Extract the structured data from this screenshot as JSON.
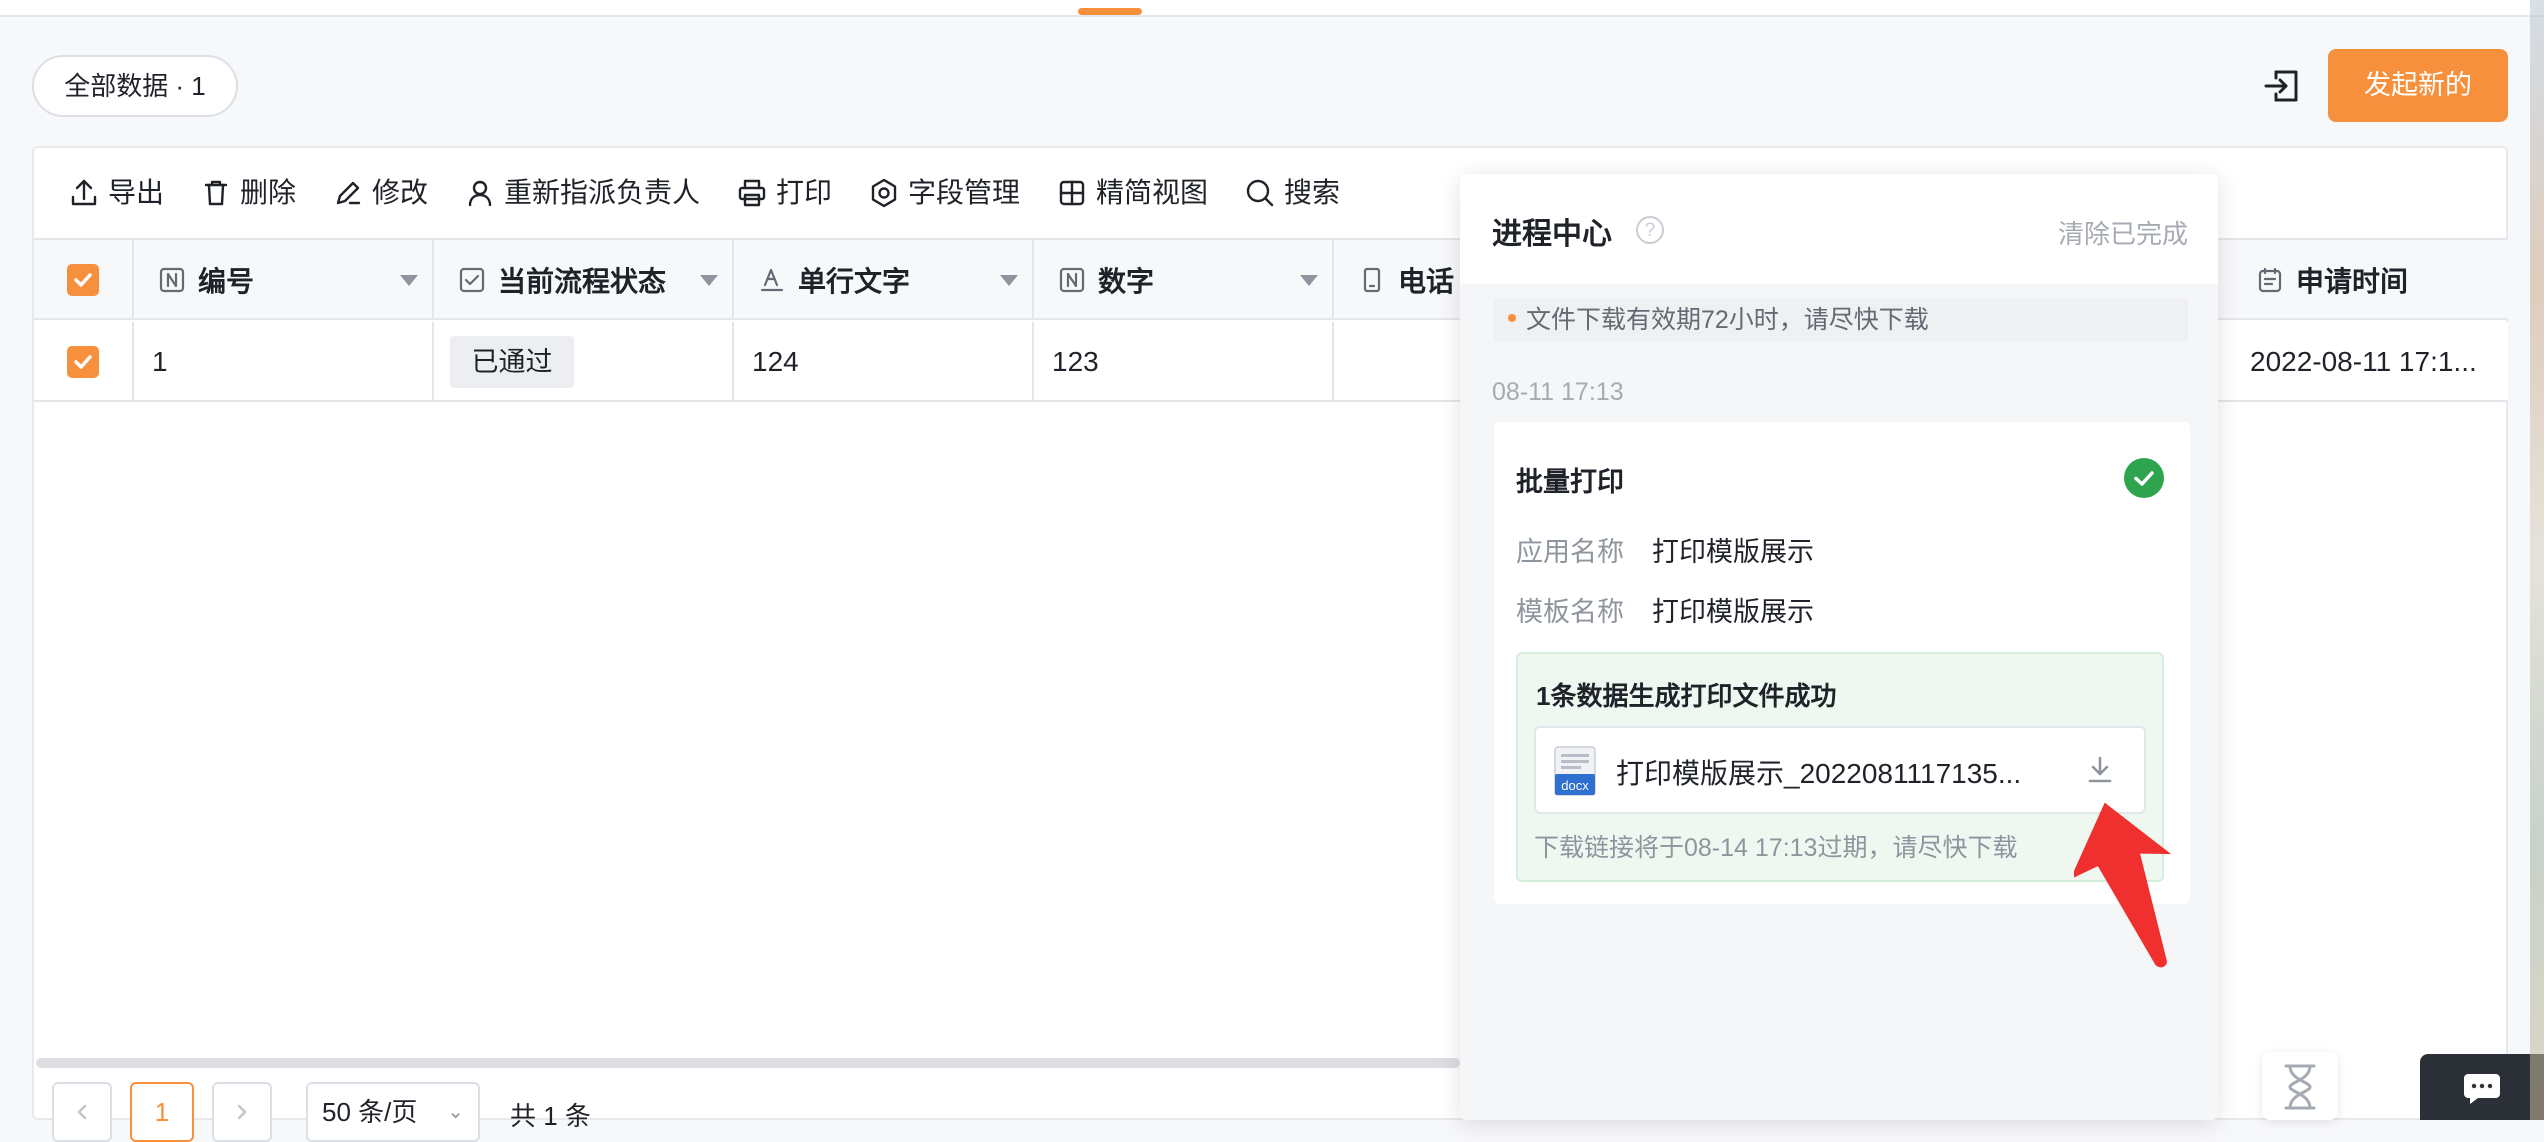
{
  "toolbar_top": {
    "filter_label": "全部数据 · 1",
    "new_button": "发起新的"
  },
  "actions": {
    "export": "导出",
    "delete": "删除",
    "edit": "修改",
    "reassign": "重新指派负责人",
    "print": "打印",
    "fields": "字段管理",
    "compact_view": "精简视图",
    "search": "搜索"
  },
  "columns": {
    "number": "编号",
    "status": "当前流程状态",
    "text": "单行文字",
    "digit": "数字",
    "phone": "电话",
    "apply_time": "申请时间"
  },
  "row": {
    "number": "1",
    "status": "已通过",
    "text": "124",
    "digit": "123",
    "apply_time": "2022-08-11 17:1..."
  },
  "pagination": {
    "current_page": "1",
    "page_size": "50 条/页",
    "total": "共 1 条"
  },
  "progress_center": {
    "title": "进程中心",
    "clear": "清除已完成",
    "notice": "文件下载有效期72小时，请尽快下载",
    "time": "08-11 17:13",
    "task": {
      "title": "批量打印",
      "app_label": "应用名称",
      "app_value": "打印模版展示",
      "template_label": "模板名称",
      "template_value": "打印模版展示",
      "result": "1条数据生成打印文件成功",
      "file_name": "打印模版展示_2022081117135...",
      "file_type": "docx",
      "expire": "下载链接将于08-14 17:13过期，请尽快下载"
    }
  },
  "colors": {
    "accent": "#f7903c",
    "success": "#2ea44f",
    "arrow": "#f0302e"
  }
}
